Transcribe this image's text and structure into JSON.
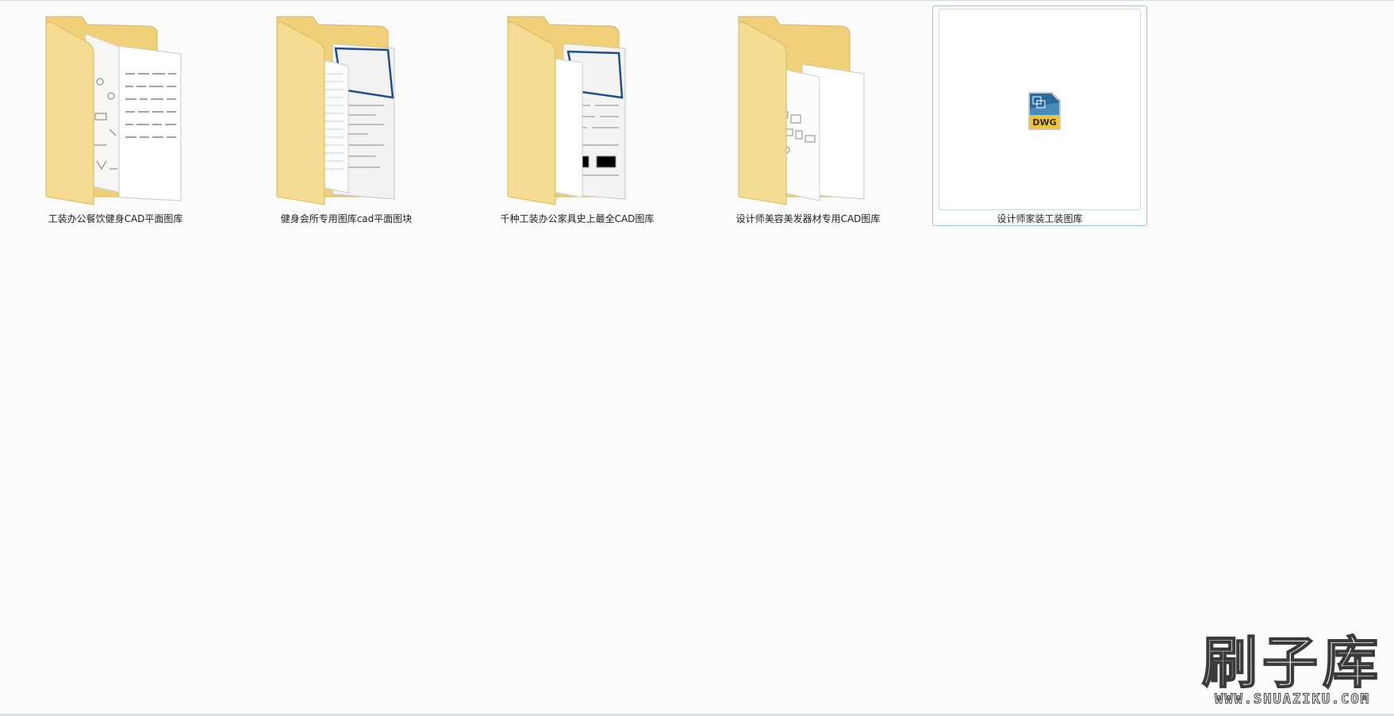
{
  "explorer": {
    "items": [
      {
        "name": "工装办公餐饮健身CAD平面图库",
        "type": "folder",
        "icon": "folder-icon",
        "selected": false
      },
      {
        "name": "健身会所专用图库cad平面图块",
        "type": "folder",
        "icon": "folder-icon",
        "selected": false
      },
      {
        "name": "千种工装办公家具史上最全CAD图库",
        "type": "folder",
        "icon": "folder-icon",
        "selected": false
      },
      {
        "name": "设计师美容美发器材专用CAD图库",
        "type": "folder",
        "icon": "folder-icon",
        "selected": false
      },
      {
        "name": "设计师家装工装图库",
        "type": "dwg-file",
        "icon": "dwg-file-icon",
        "badge": "DWG",
        "selected": true
      }
    ]
  },
  "watermark": {
    "title": "刷子库",
    "url": "WWW.SHUAZIKU.COM"
  },
  "colors": {
    "background": "#fbfbfb",
    "selection_border": "#99c4e8",
    "folder_yellow": "#f3d98a",
    "dwg_blue": "#1f5f8b",
    "dwg_yellow": "#f2c230"
  }
}
